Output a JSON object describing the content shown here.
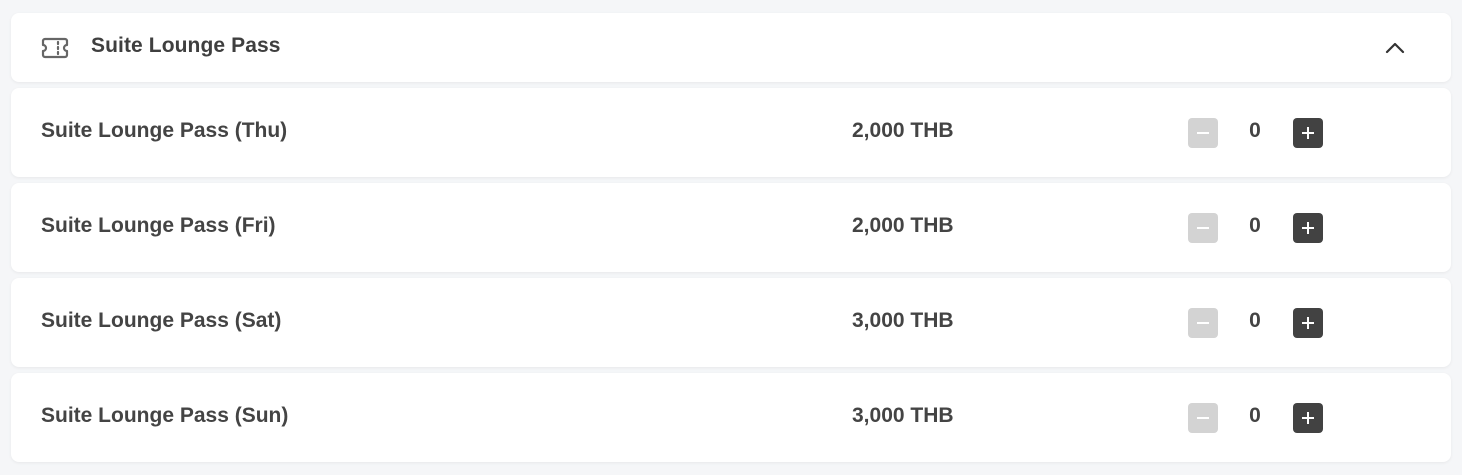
{
  "section": {
    "title": "Suite Lounge Pass",
    "icon": "ticket-icon",
    "toggle_icon": "chevron-up-icon"
  },
  "items": [
    {
      "name": "Suite Lounge Pass (Thu)",
      "price": "2,000 THB",
      "quantity": "0"
    },
    {
      "name": "Suite Lounge Pass (Fri)",
      "price": "2,000 THB",
      "quantity": "0"
    },
    {
      "name": "Suite Lounge Pass (Sat)",
      "price": "3,000 THB",
      "quantity": "0"
    },
    {
      "name": "Suite Lounge Pass (Sun)",
      "price": "3,000 THB",
      "quantity": "0"
    }
  ],
  "colors": {
    "background": "#f5f6f8",
    "card": "#ffffff",
    "text": "#444444",
    "plus_button": "#424242",
    "minus_button_disabled": "#d3d3d3"
  }
}
